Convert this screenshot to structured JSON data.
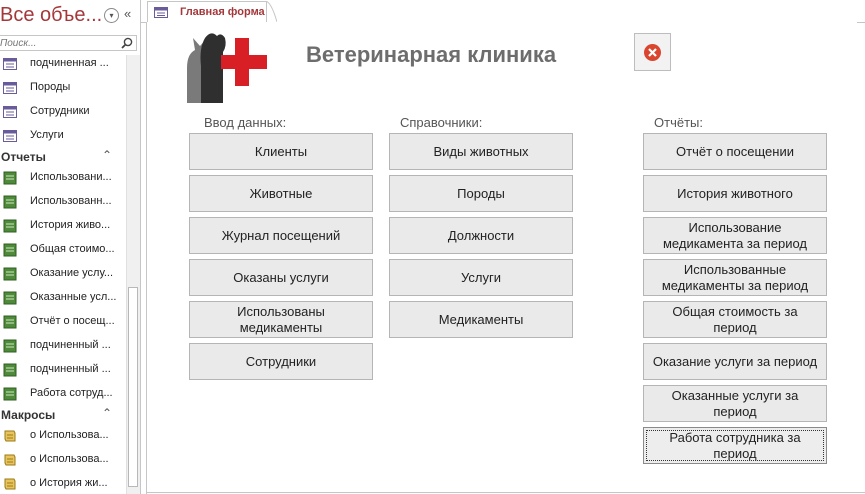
{
  "nav": {
    "title": "Все объе...",
    "search_placeholder": "Поиск...",
    "items_top": [
      {
        "label": "подчиненная ..."
      },
      {
        "label": "Породы"
      },
      {
        "label": "Сотрудники"
      },
      {
        "label": "Услуги"
      }
    ],
    "reports_group": "Отчеты",
    "reports": [
      {
        "label": "Использовани..."
      },
      {
        "label": "Использованн..."
      },
      {
        "label": "История живо..."
      },
      {
        "label": "Общая стоимо..."
      },
      {
        "label": "Оказание услу..."
      },
      {
        "label": "Оказанные усл..."
      },
      {
        "label": "Отчёт о посещ..."
      },
      {
        "label": "подчиненный ..."
      },
      {
        "label": "подчиненный ..."
      },
      {
        "label": "Работа сотруд..."
      }
    ],
    "macros_group": "Макросы",
    "macros": [
      {
        "label": "о Использова..."
      },
      {
        "label": "о Использова..."
      },
      {
        "label": "о История жи..."
      }
    ]
  },
  "tab": {
    "label": "Главная форма"
  },
  "form": {
    "title": "Ветеринарная клиника",
    "sections": {
      "input": "Ввод данных:",
      "refs": "Справочники:",
      "reports": "Отчёты:"
    },
    "input_buttons": [
      "Клиенты",
      "Животные",
      "Журнал посещений",
      "Оказаны услуги",
      "Использованы медикаменты",
      "Сотрудники"
    ],
    "ref_buttons": [
      "Виды животных",
      "Породы",
      "Должности",
      "Услуги",
      "Медикаменты"
    ],
    "report_buttons": [
      "Отчёт о посещении",
      "История животного",
      "Использование медикамента за период",
      "Использованные медикаменты за период",
      "Общая стоимость за период",
      "Оказание услуги за период",
      "Оказанные услуги за период",
      "Работа сотрудника за период"
    ]
  },
  "colors": {
    "accent": "#a4373a",
    "close_icon": "#d9452f",
    "cross": "#d81f26"
  }
}
